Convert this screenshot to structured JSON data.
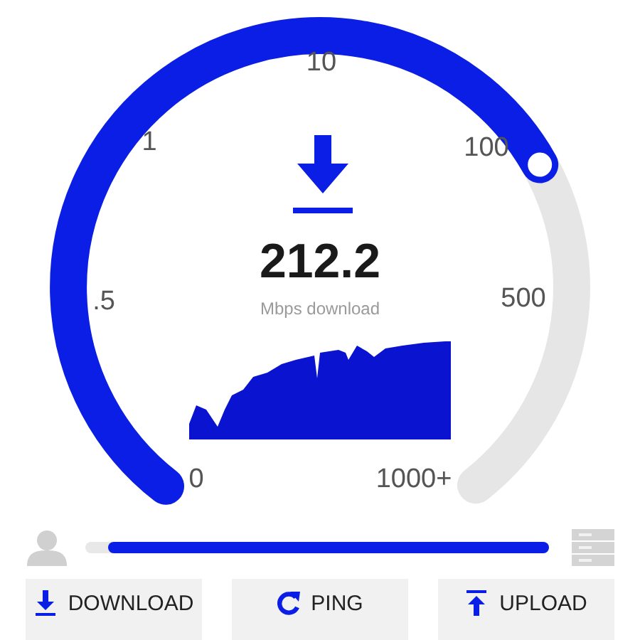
{
  "gauge": {
    "ticks": [
      "10",
      "1",
      "100",
      ".5",
      "500",
      "0",
      "1000+"
    ],
    "value": "212.2",
    "unit": "Mbps download"
  },
  "progress": {
    "level": 0.95
  },
  "results": [
    {
      "kind": "download",
      "label": "DOWNLOAD"
    },
    {
      "kind": "ping",
      "label": "PING"
    },
    {
      "kind": "upload",
      "label": "UPLOAD"
    }
  ]
}
